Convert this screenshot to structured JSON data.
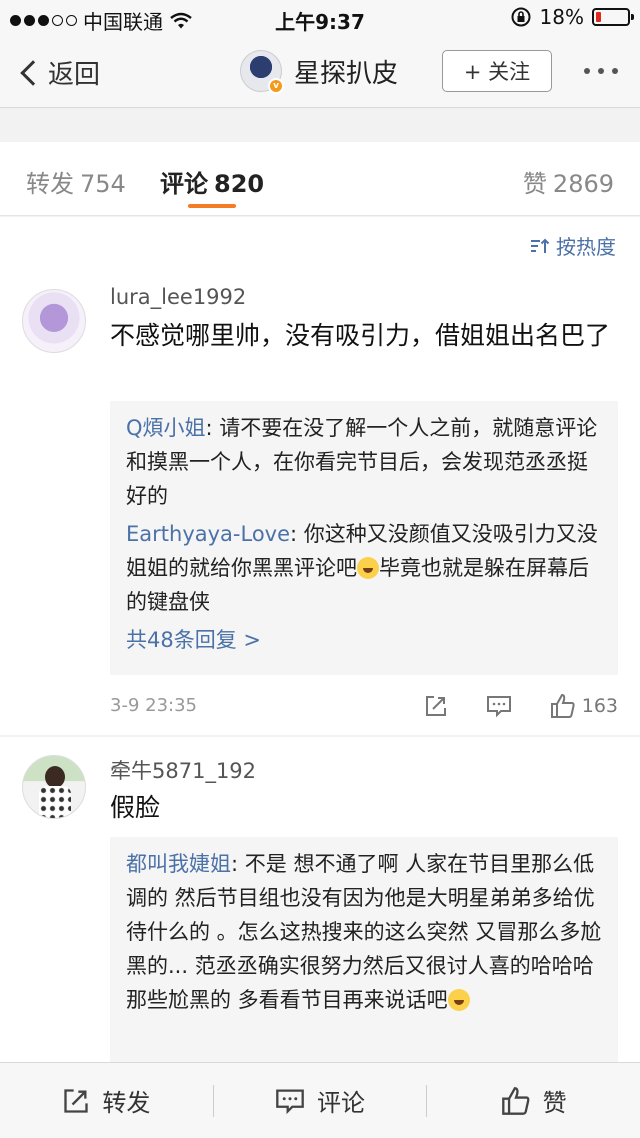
{
  "status_bar": {
    "carrier": "中国联通",
    "time": "上午9:37",
    "battery": "18%",
    "battery_level": 0.18
  },
  "nav": {
    "back_label": "返回",
    "title": "星探扒皮",
    "follow_label": "+ 关注"
  },
  "tabs": {
    "repost": {
      "label": "转发",
      "count": "754"
    },
    "comment": {
      "label": "评论",
      "count": "820"
    },
    "like": {
      "label": "赞",
      "count": "2869"
    }
  },
  "sort_label": "按热度",
  "comments": [
    {
      "user": "lura_lee1992",
      "text": "不感觉哪里帅，没有吸引力，借姐姐出名巴了",
      "replies": [
        {
          "name": "Q煩小姐",
          "text": "请不要在没了解一个人之前，就随意评论和摸黑一个人，在你看完节目后，会发现范丞丞挺好的"
        },
        {
          "name": "Earthyaya-Love",
          "text": "你这种又没颜值又没吸引力又没姐姐的就给你黑黑评论吧",
          "text_after_emoji": "毕竟也就是躲在屏幕后的键盘侠"
        }
      ],
      "more_replies": "共48条回复 >",
      "time": "3-9 23:35",
      "likes": "163"
    },
    {
      "user": "牵牛5871_192",
      "text": "假脸",
      "replies": [
        {
          "name": "都叫我婕姐",
          "text": "不是 想不通了啊 人家在节目里那么低调的 然后节目组也没有因为他是大明星弟弟多给优待什么的 。怎么这热搜来的这么突然 又冒那么多尬黑的...    范丞丞确实很努力然后又很讨人喜的哈哈哈 那些尬黑的 多看看节目再来说话吧"
        }
      ]
    }
  ],
  "bottom_bar": {
    "repost": "转发",
    "comment": "评论",
    "like": "赞"
  },
  "colors": {
    "link": "#4b72a8",
    "accent": "#f47c25",
    "verified": "#f39a1b"
  },
  "icons": [
    "wifi-icon",
    "lock-rotation-icon",
    "battery-icon",
    "back-chevron-icon",
    "sort-icon",
    "repost-icon",
    "comment-icon",
    "like-icon",
    "more-icon"
  ]
}
